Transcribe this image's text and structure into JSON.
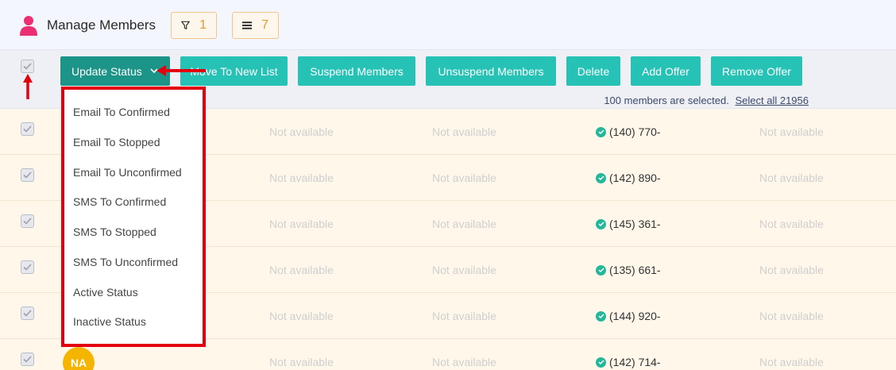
{
  "header": {
    "title": "Manage Members",
    "filter_count": "1",
    "list_count": "7"
  },
  "toolbar": {
    "buttons": [
      "Update Status",
      "Move To New List",
      "Suspend Members",
      "Unsuspend Members",
      "Delete",
      "Add Offer",
      "Remove Offer"
    ],
    "selected_text": "100 members are selected.",
    "select_all_link": "Select all 21956"
  },
  "status_menu": {
    "items": [
      "Email To Confirmed",
      "Email To Stopped",
      "Email To Unconfirmed",
      "SMS To Confirmed",
      "SMS To Stopped",
      "SMS To Unconfirmed",
      "Active Status",
      "Inactive Status"
    ]
  },
  "rows": [
    {
      "col_a": "Not available",
      "col_b": "Not available",
      "phone": "(140) 770-",
      "col_c": "Not available"
    },
    {
      "col_a": "Not available",
      "col_b": "Not available",
      "phone": "(142) 890-",
      "col_c": "Not available"
    },
    {
      "col_a": "Not available",
      "col_b": "Not available",
      "phone": "(145) 361-",
      "col_c": "Not available"
    },
    {
      "col_a": "Not available",
      "col_b": "Not available",
      "phone": "(135) 661-",
      "col_c": "Not available"
    },
    {
      "col_a": "Not available",
      "col_b": "Not available",
      "phone": "(144) 920-",
      "col_c": "Not available"
    },
    {
      "col_a": "Not available",
      "col_b": "Not available",
      "phone": "(142) 714-",
      "col_c": "Not available",
      "avatar": "NA"
    }
  ],
  "colors": {
    "accent": "#26c2b5",
    "accent_dark": "#1d9488",
    "highlight": "#e3000f",
    "row_bg": "#fff7ea"
  }
}
